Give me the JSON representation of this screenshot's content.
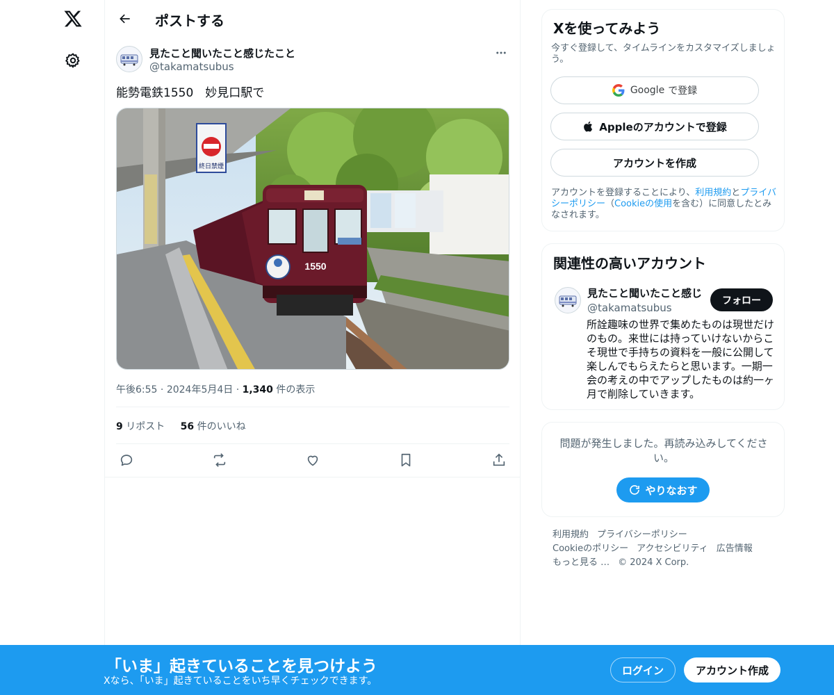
{
  "header": {
    "title": "ポストする"
  },
  "post": {
    "author_name": "見たこと聞いたこと感じたこと",
    "author_handle": "@takamatsubus",
    "text": "能勢電鉄1550　妙見口駅で",
    "image": {
      "car_number": "1550",
      "sign_top": "終日禁煙"
    },
    "time": "午後6:55",
    "date": "2024年5月4日",
    "views_count": "1,340",
    "views_label": "件の表示",
    "reposts_count": "9",
    "reposts_label": "リポスト",
    "likes_count": "56",
    "likes_label": "件のいいね"
  },
  "signup": {
    "title": "Xを使ってみよう",
    "subtitle": "今すぐ登録して、タイムラインをカスタマイズしましょう。",
    "google_brand": "Google",
    "google_suffix": "で登録",
    "apple_label": "Appleのアカウントで登録",
    "create_label": "アカウントを作成",
    "legal_prefix": "アカウントを登録することにより、",
    "legal_terms": "利用規約",
    "legal_and": "と",
    "legal_privacy": "プライバシーポリシー",
    "legal_paren_open": "（",
    "legal_cookie": "Cookieの使用",
    "legal_rest": "を含む）に同意したとみなされます。"
  },
  "related": {
    "title": "関連性の高いアカウント",
    "name": "見たこと聞いたこと感じ",
    "handle": "@takamatsubus",
    "follow_label": "フォロー",
    "bio": "所詮趣味の世界で集めたものは現世だけのもの。来世には持っていけないからこそ現世で手持ちの資料を一般に公開して楽しんでもらえたらと思います。一期一会の考えの中でアップしたものは約一ヶ月で削除していきます。"
  },
  "error_card": {
    "message": "問題が発生しました。再読み込みしてください。",
    "retry_label": "やりなおす"
  },
  "footer": {
    "links": [
      "利用規約",
      "プライバシーポリシー",
      "Cookieのポリシー",
      "アクセシビリティ",
      "広告情報",
      "もっと見る …"
    ],
    "copyright": "© 2024 X Corp."
  },
  "bottom_bar": {
    "title": "「いま」起きていることを見つけよう",
    "subtitle": "Xなら、「いま」起きていることをいち早くチェックできます。",
    "login_label": "ログイン",
    "create_label": "アカウント作成"
  },
  "colors": {
    "accent": "#1d9bf0",
    "text": "#0f1419",
    "muted": "#536471",
    "border": "#eff3f4",
    "train_body": "#6b1a2a"
  },
  "icons": [
    "x-logo-icon",
    "gear-icon",
    "back-arrow-icon",
    "more-icon",
    "reply-icon",
    "repost-icon",
    "like-icon",
    "bookmark-icon",
    "share-icon",
    "google-icon",
    "apple-icon",
    "refresh-icon"
  ]
}
